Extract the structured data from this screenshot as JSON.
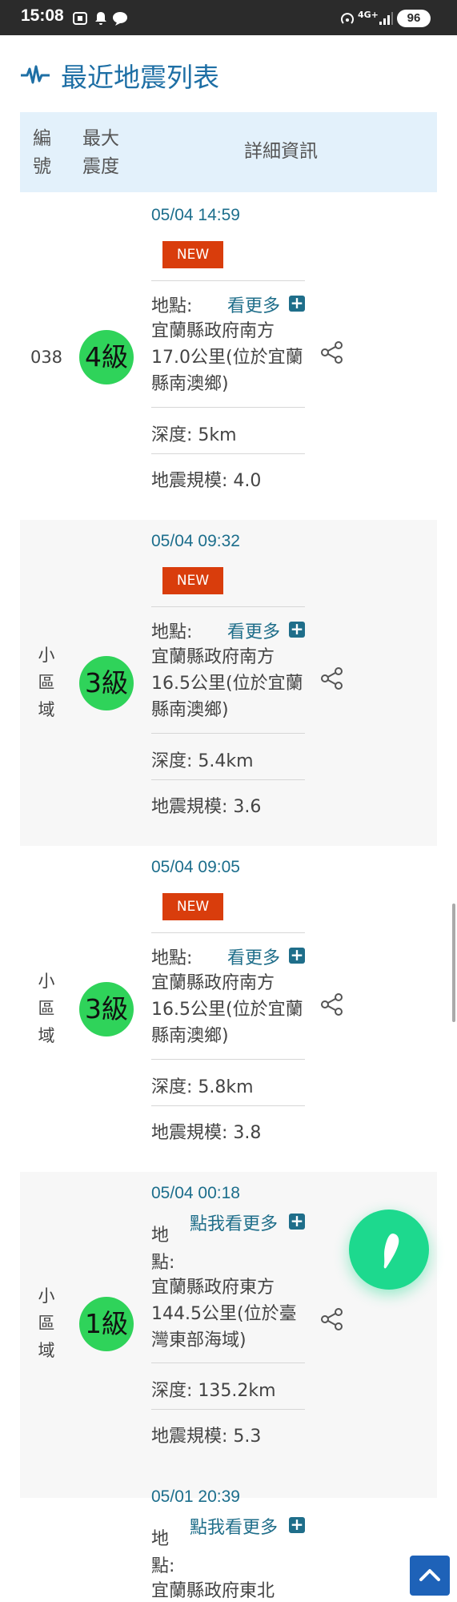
{
  "status_bar": {
    "time": "15:08",
    "network": "4G+",
    "battery": "96"
  },
  "page": {
    "title": "最近地震列表"
  },
  "table": {
    "headers": [
      "編號",
      "最大震度",
      "詳細資訊"
    ]
  },
  "labels": {
    "location": "地點:",
    "location_stacked": "地點:",
    "more": "看更多",
    "more_tap": "點我看更多",
    "new_badge": "NEW"
  },
  "quakes": [
    {
      "number": "038",
      "intensity": "4級",
      "datetime": "05/04 14:59",
      "is_new": true,
      "place": "宜蘭縣政府南方17.0公里(位於宜蘭縣南澳鄉)",
      "depth": "深度: 5km",
      "magnitude": "地震規模: 4.0"
    },
    {
      "number": "小區域",
      "intensity": "3級",
      "datetime": "05/04 09:32",
      "is_new": true,
      "place": "宜蘭縣政府南方16.5公里(位於宜蘭縣南澳鄉)",
      "depth": "深度: 5.4km",
      "magnitude": "地震規模: 3.6"
    },
    {
      "number": "小區域",
      "intensity": "3級",
      "datetime": "05/04 09:05",
      "is_new": true,
      "place": "宜蘭縣政府南方16.5公里(位於宜蘭縣南澳鄉)",
      "depth": "深度: 5.8km",
      "magnitude": "地震規模: 3.8"
    },
    {
      "number": "小區域",
      "intensity": "1級",
      "datetime": "05/04 00:18",
      "is_new": false,
      "place": "宜蘭縣政府東方144.5公里(位於臺灣東部海域)",
      "depth": "深度: 135.2km",
      "magnitude": "地震規模: 5.3"
    },
    {
      "number": "",
      "intensity": "",
      "datetime": "05/01 20:39",
      "is_new": false,
      "place": "宜蘭縣政府東北",
      "depth": "",
      "magnitude": ""
    }
  ],
  "colors": {
    "title_blue": "#1e6fa5",
    "header_bg": "#e3f1fb",
    "date_teal": "#1c6e8c",
    "new_red": "#d93d0c",
    "intensity_green": "#2fd35a",
    "fab_green": "#1dd98e",
    "to_top_blue": "#1e62b8"
  },
  "icons": {
    "title": "seismograph-wave-icon",
    "share": "share-icon",
    "more": "plus-square-icon",
    "fab": "taiwan-map-icon",
    "to_top": "chevron-up-icon"
  }
}
